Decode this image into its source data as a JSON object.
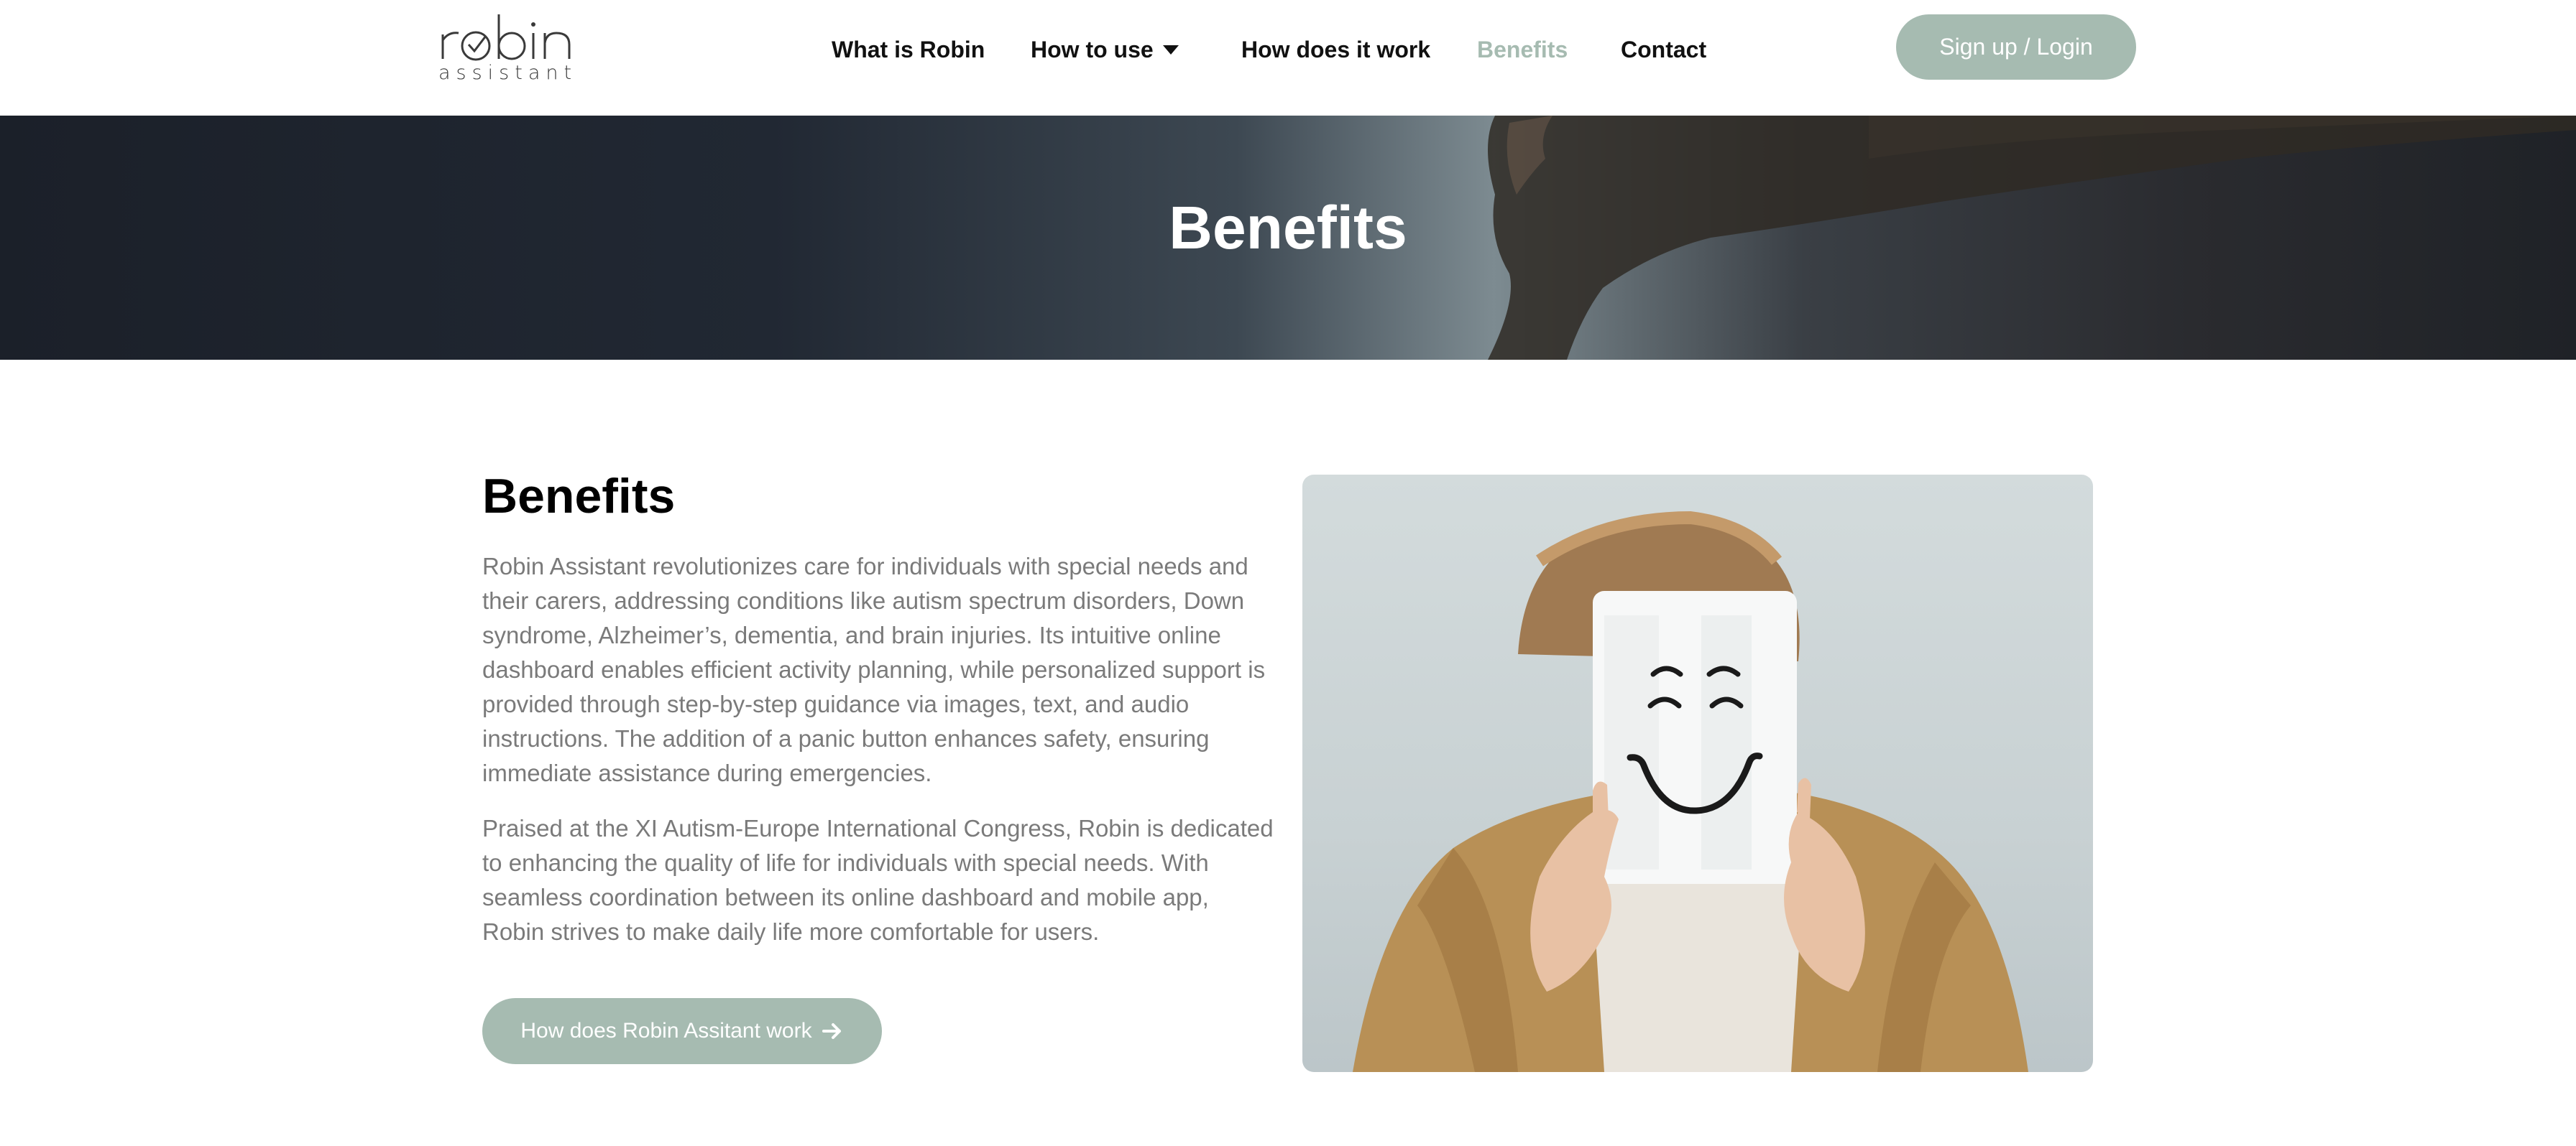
{
  "header": {
    "logo": {
      "word": "robin",
      "subtitle": "assistant"
    },
    "nav": {
      "what_is": "What is Robin",
      "how_to_use": "How to use",
      "how_it_works": "How does it work",
      "benefits": "Benefits",
      "contact": "Contact"
    },
    "signup_label": "Sign up / Login"
  },
  "hero": {
    "title": "Benefits"
  },
  "main": {
    "title": "Benefits",
    "paragraph_1": "Robin Assistant revolutionizes care for individuals with special needs and their carers, addressing conditions like autism spectrum disorders, Down syndrome, Alzheimer’s, dementia, and brain injuries. Its intuitive online dashboard enables efficient activity planning, while personalized support is provided through step-by-step guidance via images, text, and audio instructions. The addition of a panic button enhances safety, ensuring immediate assistance during emergencies.",
    "paragraph_2": "Praised at the XI Autism-Europe International Congress, Robin is dedicated to enhancing the quality of life for individuals with special needs. With seamless coordination between its online dashboard and mobile app, Robin strives to make daily life more comfortable for users.",
    "cta_label": "How does Robin Assitant work",
    "cta_icon": "arrow-right-icon",
    "image_subject": "smiley-face-card-photo"
  },
  "colors": {
    "accent": "#a6bbb1",
    "text_dark": "#111111",
    "text_muted": "#7a7a7a",
    "hero_dark": "#1f2430"
  }
}
